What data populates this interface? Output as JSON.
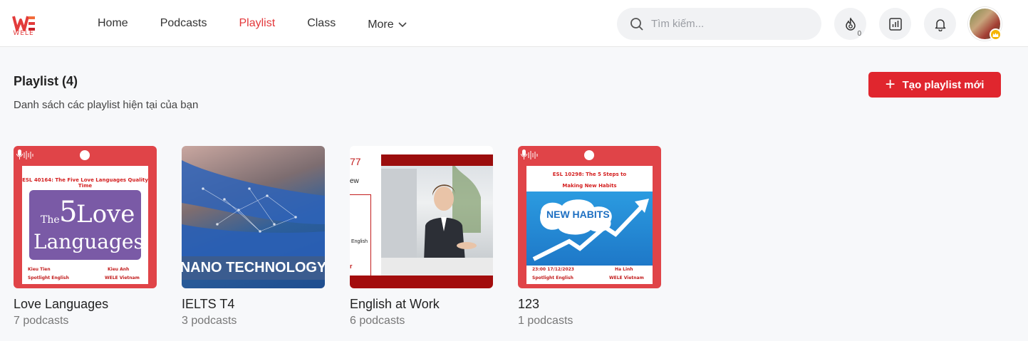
{
  "header": {
    "logo_text": "WELE",
    "nav": [
      {
        "label": "Home",
        "active": false
      },
      {
        "label": "Podcasts",
        "active": false
      },
      {
        "label": "Playlist",
        "active": true
      },
      {
        "label": "Class",
        "active": false
      }
    ],
    "more_label": "More",
    "search_placeholder": "Tìm kiếm...",
    "streak_count": "0"
  },
  "section": {
    "title": "Playlist (4)",
    "subtitle": "Danh sách các playlist hiện tại của bạn",
    "create_button_label": "Tạo playlist mới"
  },
  "playlists": [
    {
      "name": "Love Languages",
      "count": "7 podcasts",
      "thumb": {
        "episode_title": "ESL 40164: The Five Love Languages Quality Time",
        "art_top": "The",
        "art_number": "5",
        "art_word1": "Love",
        "art_word2": "Languages",
        "host_left": "Kieu Tien",
        "host_right": "Kieu Anh",
        "brand_left": "Spotlight English",
        "brand_right": "WELE Vietnam"
      }
    },
    {
      "name": "IELTS T4",
      "count": "3 podcasts",
      "thumb": {
        "band_text": "NANO TECHNOLOGY"
      }
    },
    {
      "name": "English at Work",
      "count": "6 podcasts",
      "thumb": {
        "frag_top": "77",
        "frag_mid": "ew",
        "frag_lower": "English",
        "frag_bottom": "r"
      }
    },
    {
      "name": "123",
      "count": "1 podcasts",
      "thumb": {
        "episode_title_line1": "ESL 10298: The 5 Steps to",
        "episode_title_line2": "Making New Habits",
        "art_text": "NEW HABITS",
        "time_text": "23:00 17/12/2023",
        "host_right": "Ha Linh",
        "brand_left": "Spotlight English",
        "brand_right": "WELE Vietnam"
      }
    }
  ],
  "colors": {
    "accent": "#e0262e",
    "active_nav": "#e3373a",
    "frame_red": "#e04448"
  }
}
